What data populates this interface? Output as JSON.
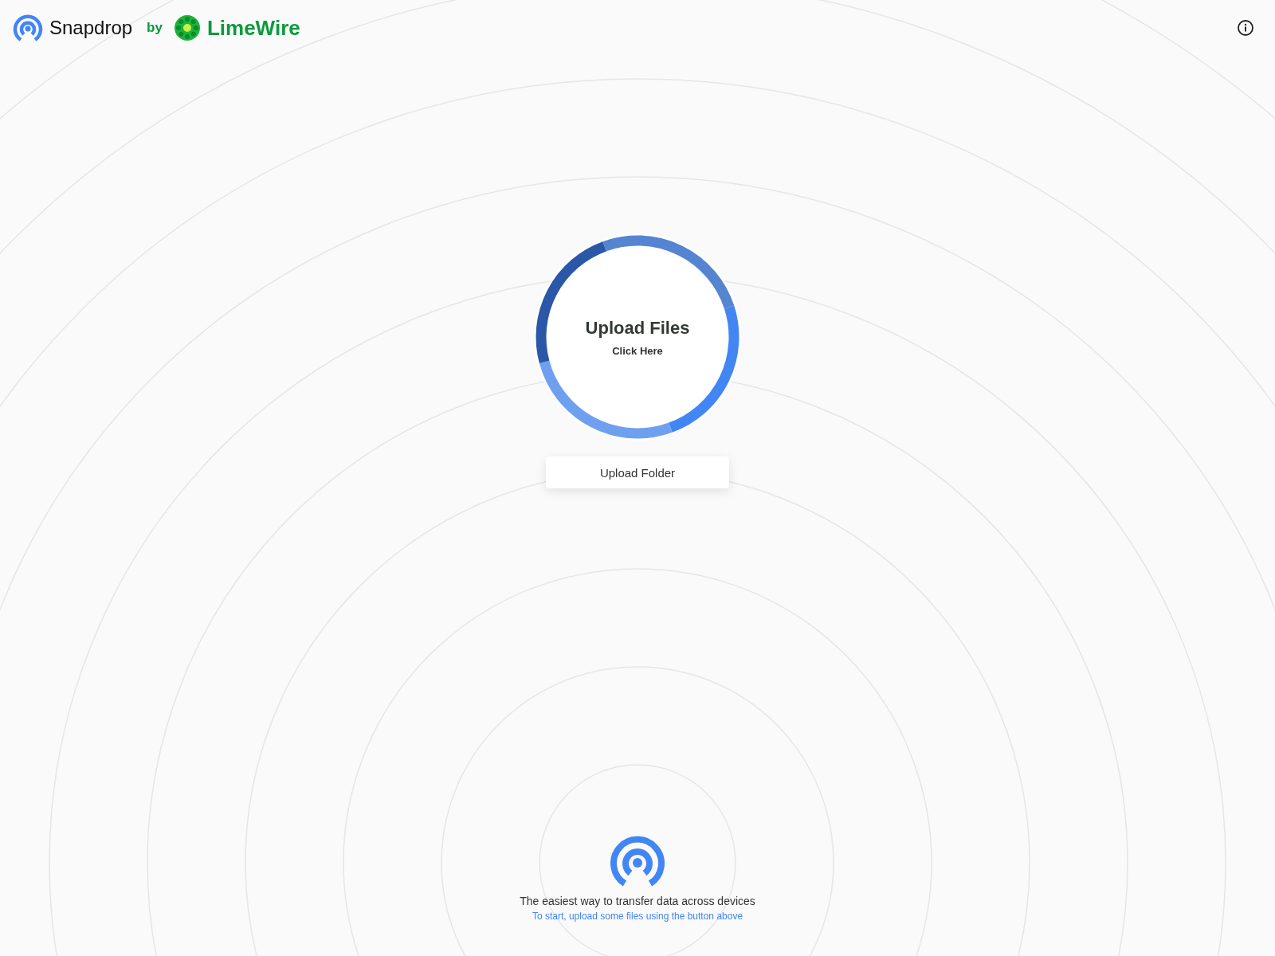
{
  "header": {
    "brand": "Snapdrop",
    "by": "by",
    "partner": "LimeWire"
  },
  "upload": {
    "title": "Upload Files",
    "subtitle": "Click Here"
  },
  "folder_button": {
    "label": "Upload Folder"
  },
  "footer": {
    "tagline": "The easiest way to transfer data across devices",
    "hint": "To start, upload some files using the button above"
  }
}
